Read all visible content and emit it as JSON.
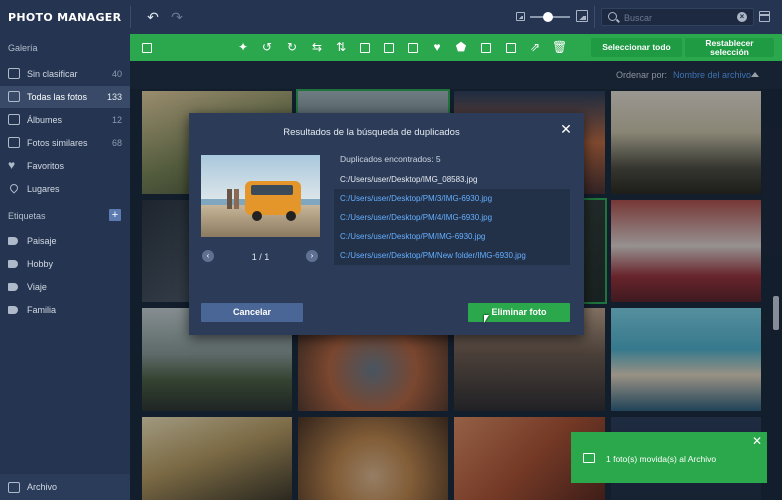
{
  "app": {
    "title_bold": "PHOTO MANAGER"
  },
  "search": {
    "placeholder": "Buscar"
  },
  "sidebar": {
    "gallery_heading": "Galería",
    "items": [
      {
        "label": "Sin clasificar",
        "count": "40",
        "icon": "folder-icon"
      },
      {
        "label": "Todas las fotos",
        "count": "133",
        "icon": "photos-icon"
      },
      {
        "label": "Álbumes",
        "count": "12",
        "icon": "albums-icon"
      },
      {
        "label": "Fotos similares",
        "count": "68",
        "icon": "similar-photos-icon"
      },
      {
        "label": "Favoritos",
        "count": "",
        "icon": "heart-icon"
      },
      {
        "label": "Lugares",
        "count": "",
        "icon": "pin-icon"
      }
    ],
    "tags_heading": "Etiquetas",
    "tags": [
      "Paisaje",
      "Hobby",
      "Viaje",
      "Familia"
    ],
    "archive": "Archivo"
  },
  "toolbar": {
    "select_all": "Seleccionar todo",
    "reset_line1": "Restablecer",
    "reset_line2": "selección"
  },
  "sort": {
    "label": "Ordenar por:",
    "value": "Nombre del archivo"
  },
  "modal": {
    "title": "Resultados de la búsqueda de duplicados",
    "found": "Duplicados encontrados: 5",
    "pager": "1 / 1",
    "files": [
      "C:/Users/user/Desktop/IMG_08583.jpg",
      "C:/Users/user/Desktop/PM/3/IMG-6930.jpg",
      "C:/Users/user/Desktop/PM/4/IMG-6930.jpg",
      "C:/Users/user/Desktop/PM/IMG-6930.jpg",
      "C:/Users/user/Desktop/PM/New folder/IMG-6930.jpg"
    ],
    "cancel": "Cancelar",
    "delete": "Eliminar foto"
  },
  "toast": {
    "message": "1 foto(s) movida(s) al Archivo"
  },
  "colors": {
    "accent_green": "#2ba84d",
    "link_blue": "#5aa6ff",
    "sidebar_bg": "#253450",
    "modal_bg": "#2b3b58"
  }
}
